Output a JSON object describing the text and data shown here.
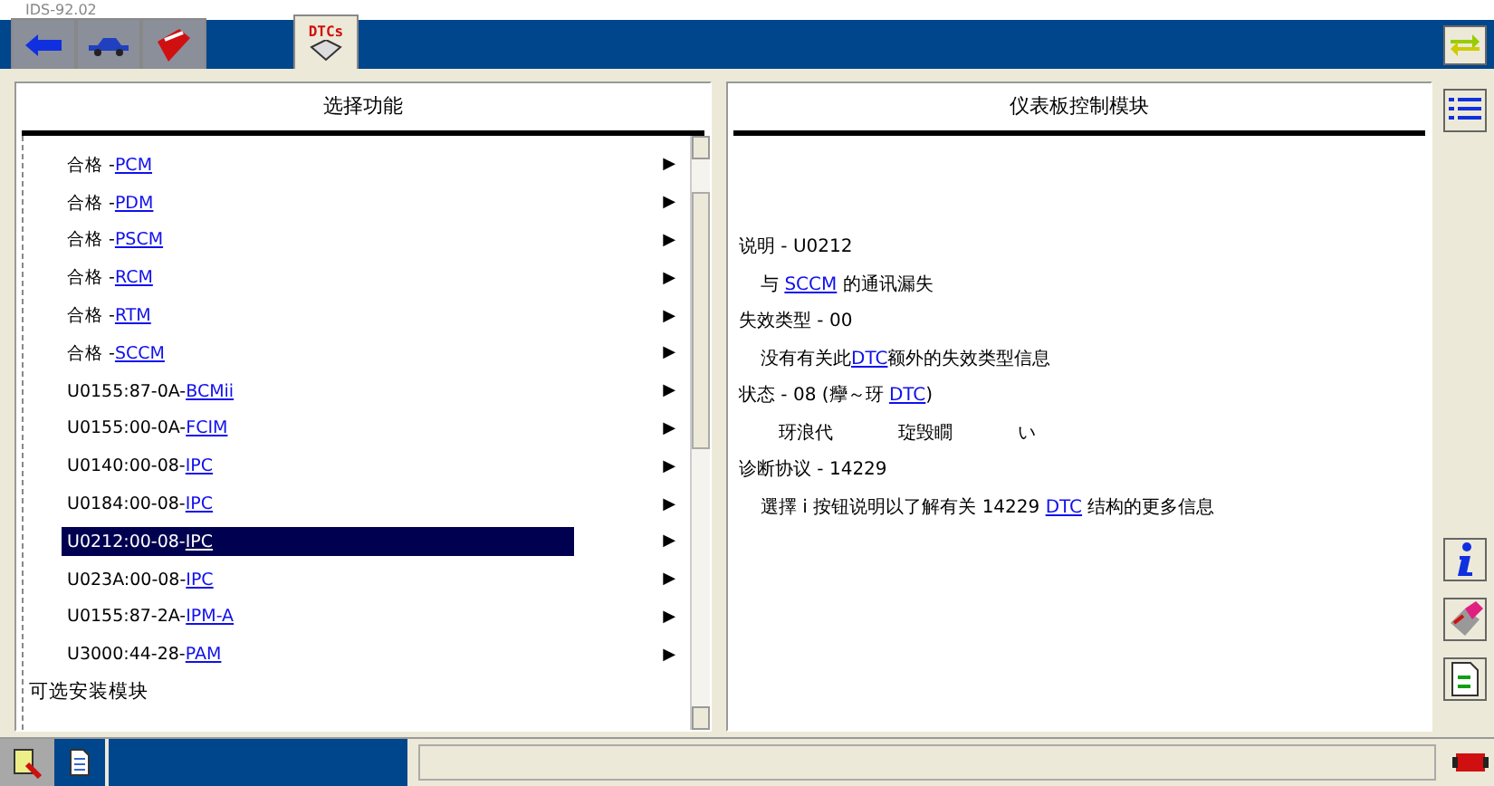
{
  "window": {
    "title": "IDS-92.02"
  },
  "toolbar": {
    "tabs": [
      {
        "kind": "back",
        "selected": false
      },
      {
        "kind": "vehicle",
        "selected": false
      },
      {
        "kind": "toolbox",
        "selected": false
      },
      {
        "kind": "dtc",
        "label": "DTCs",
        "selected": true
      }
    ]
  },
  "left_panel": {
    "title": "选择功能",
    "rows": [
      {
        "kind": "item",
        "prefix": "合格 - ",
        "link": "PCM",
        "arrow": "▶",
        "selected": false
      },
      {
        "kind": "item",
        "prefix": "合格 - ",
        "link": "PDM",
        "arrow": "▶",
        "selected": false
      },
      {
        "kind": "item",
        "prefix": "合格 - ",
        "link": "PSCM",
        "arrow": "▶",
        "selected": false
      },
      {
        "kind": "item",
        "prefix": "合格 - ",
        "link": "RCM",
        "arrow": "▶",
        "selected": false
      },
      {
        "kind": "item",
        "prefix": "合格 - ",
        "link": "RTM",
        "arrow": "▶",
        "selected": false
      },
      {
        "kind": "item",
        "prefix": "合格 - ",
        "link": "SCCM",
        "arrow": "▶",
        "selected": false
      },
      {
        "kind": "item",
        "prefix": "U0155:87-0A- ",
        "link": "BCMii",
        "arrow": "▶",
        "selected": false
      },
      {
        "kind": "item",
        "prefix": "U0155:00-0A- ",
        "link": "FCIM",
        "arrow": "▶",
        "selected": false
      },
      {
        "kind": "item",
        "prefix": "U0140:00-08- ",
        "link": "IPC",
        "arrow": "▶",
        "selected": false
      },
      {
        "kind": "item",
        "prefix": "U0184:00-08- ",
        "link": "IPC",
        "arrow": "▶",
        "selected": false
      },
      {
        "kind": "item",
        "prefix": "U0212:00-08- ",
        "link": "IPC",
        "arrow": "▶",
        "selected": true
      },
      {
        "kind": "item",
        "prefix": "U023A:00-08- ",
        "link": "IPC",
        "arrow": "▶",
        "selected": false
      },
      {
        "kind": "item",
        "prefix": "U0155:87-2A- ",
        "link": "IPM-A",
        "arrow": "▶",
        "selected": false
      },
      {
        "kind": "item",
        "prefix": "U3000:44-28- ",
        "link": "PAM",
        "arrow": "▶",
        "selected": false
      },
      {
        "kind": "section",
        "text": "可选安装模块"
      }
    ]
  },
  "right_panel": {
    "title": "仪表板控制模块",
    "lines": [
      {
        "kind": "label",
        "text": "说明 - U0212"
      },
      {
        "kind": "detail",
        "parts": [
          {
            "text": "与 "
          },
          {
            "text": "SCCM",
            "link": true
          },
          {
            "text": " 的通讯漏失"
          }
        ]
      },
      {
        "kind": "label",
        "text": "失效类型 - 00"
      },
      {
        "kind": "detail",
        "parts": [
          {
            "text": "没有有关此"
          },
          {
            "text": "DTC",
            "link": true
          },
          {
            "text": "额外的失效类型信息"
          }
        ]
      },
      {
        "kind": "label_parts",
        "parts": [
          {
            "text": "状态 - 08 (癴～玡 "
          },
          {
            "text": "DTC",
            "link": true
          },
          {
            "text": ")"
          }
        ]
      },
      {
        "kind": "detail2",
        "parts": [
          {
            "text": "玡浪代"
          },
          {
            "text": "琁毁瞯"
          },
          {
            "text": "い"
          }
        ]
      },
      {
        "kind": "label",
        "text": "诊断协议 - 14229"
      },
      {
        "kind": "detail",
        "parts": [
          {
            "text": "選擇 i 按钮说明以了解有关 14229 "
          },
          {
            "text": "DTC",
            "link": true
          },
          {
            "text": " 结构的更多信息"
          }
        ]
      }
    ]
  },
  "side_buttons": [
    {
      "kind": "list"
    },
    {
      "kind": "info"
    },
    {
      "kind": "eraser"
    },
    {
      "kind": "refresh"
    }
  ]
}
